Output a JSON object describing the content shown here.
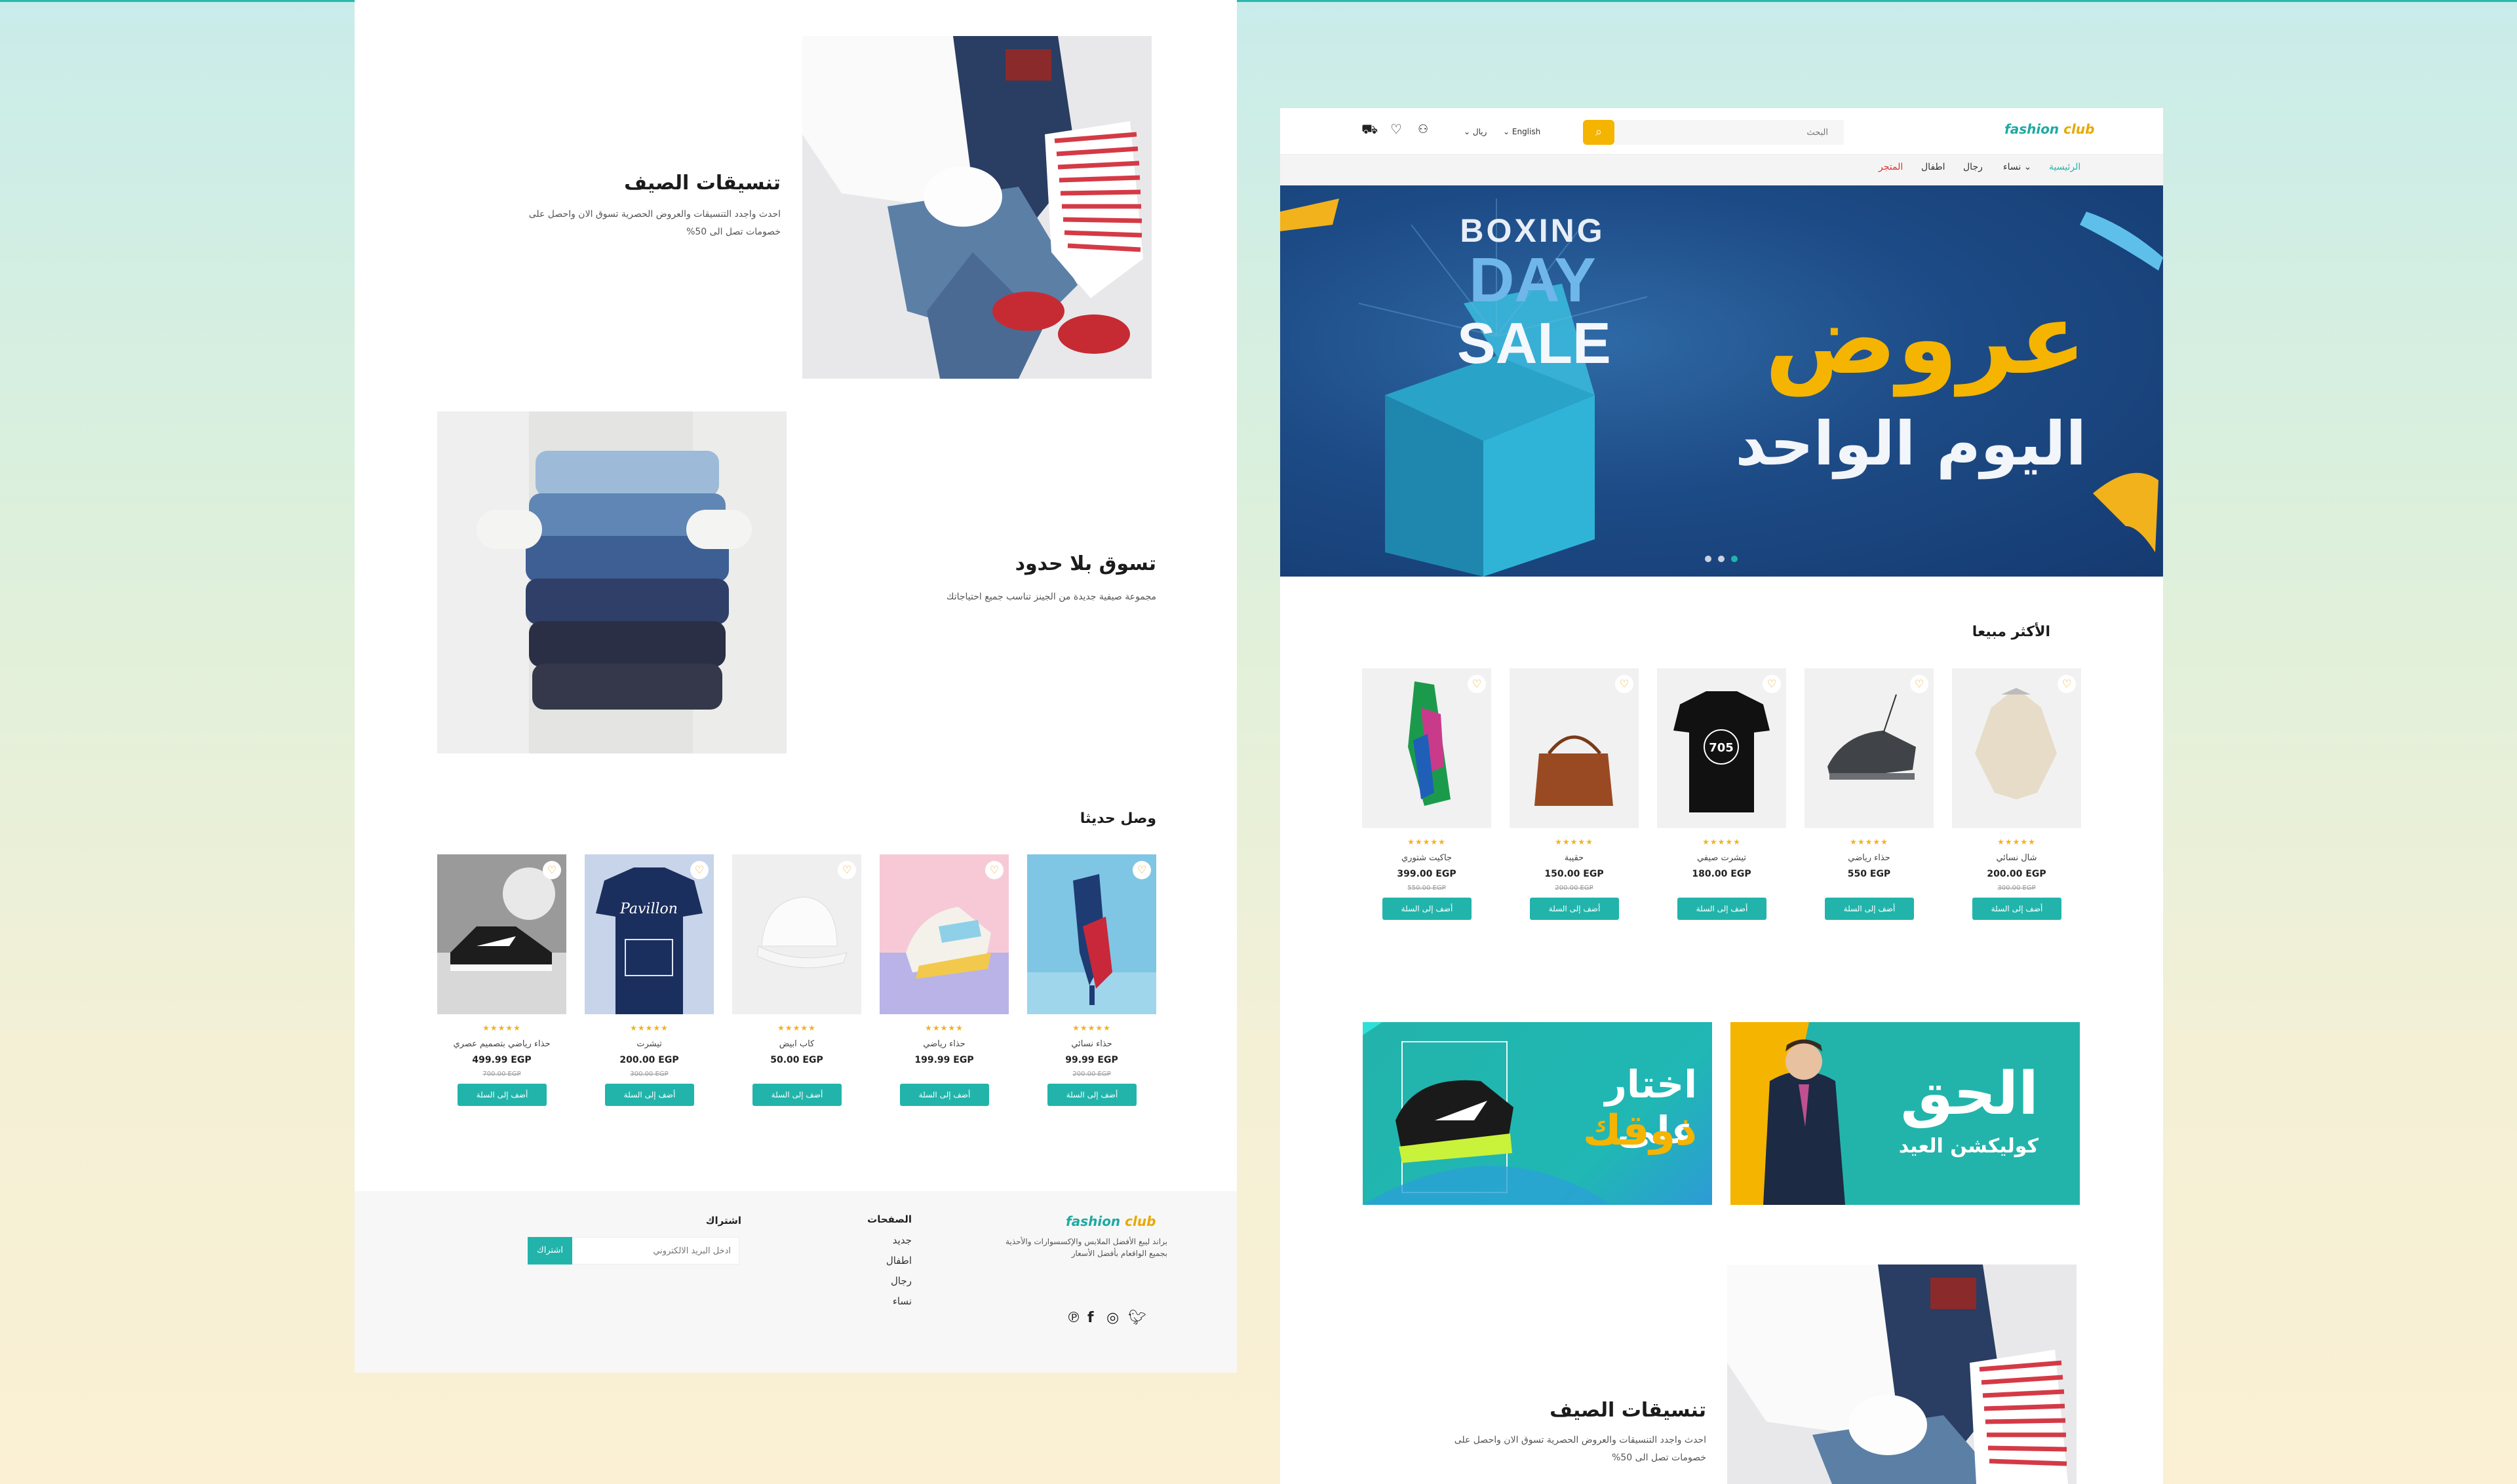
{
  "colors": {
    "accent": "#22b4ab",
    "brand_yellow": "#f5b400",
    "sale_red": "#e03131"
  },
  "brand": {
    "logo_part1": "fashion",
    "logo_part2": "club"
  },
  "left_panel": {
    "summer": {
      "title": "تنسيقات الصيف",
      "desc_line1": "احدث واجدد التنسيقات والعروض الحصرية تسوق الان واحصل على",
      "desc_line2": "خصومات تصل الى 50%"
    },
    "shop": {
      "title": "تسوق بلا حدود",
      "desc": "مجموعة صيفية جديدة من الجينز تناسب جميع احتياجاتك"
    },
    "new_arrivals": {
      "title": "وصل حديثا",
      "products": [
        {
          "name": "حذاء نسائي",
          "price": "99.99 EGP",
          "old": "200.00 EGP",
          "stars": "★★★★★",
          "cta": "أضف إلى السلة"
        },
        {
          "name": "حذاء رياضي",
          "price": "199.99 EGP",
          "old": "",
          "stars": "★★★★★",
          "cta": "أضف إلى السلة"
        },
        {
          "name": "كاب ابيض",
          "price": "50.00 EGP",
          "old": "",
          "stars": "★★★★★",
          "cta": "أضف إلى السلة"
        },
        {
          "name": "تيشرت",
          "price": "200.00 EGP",
          "old": "300.00 EGP",
          "stars": "★★★★★",
          "cta": "أضف إلى السلة"
        },
        {
          "name": "حذاء رياضي بتصميم عصري",
          "price": "499.99 EGP",
          "old": "700.00 EGP",
          "stars": "★★★★★",
          "cta": "أضف إلى السلة"
        }
      ]
    },
    "footer": {
      "about_line1": "براند ليبع الأفضل الملابس والإكسسوارات والأحذية",
      "about_line2": "بجميع الواقعام بأفضل الأسعار",
      "pages_title": "الصفحات",
      "pages": [
        "جديد",
        "اطفال",
        "رجال",
        "نساء"
      ],
      "subscribe_title": "اشتراك",
      "email_placeholder": "ادخل البريد الالكتروني",
      "subscribe_btn": "اشتراك"
    }
  },
  "right_panel": {
    "header": {
      "search_placeholder": "البحث",
      "language": "English",
      "currency": "ريال"
    },
    "nav": {
      "home": "الرئيسية",
      "women": "نساء",
      "men": "رجال",
      "kids": "اطفال",
      "store": "المتجر"
    },
    "hero": {
      "boxing": "BOXING",
      "day": "DAY",
      "sale": "SALE",
      "offer_title": "عروض",
      "offer_sub": "اليوم الواحد"
    },
    "best_sellers": {
      "title": "الأكثر مبيعا",
      "products": [
        {
          "name": "شال نسائي",
          "price": "200.00 EGP",
          "old": "300.00 EGP",
          "stars": "★★★★★",
          "cta": "أضف إلى السلة"
        },
        {
          "name": "حذاء رياضي",
          "price": "550 EGP",
          "old": "",
          "stars": "★★★★★",
          "cta": "أضف إلى السلة"
        },
        {
          "name": "تيشرت صيفي",
          "price": "180.00 EGP",
          "old": "",
          "stars": "★★★★★",
          "cta": "أضف إلى السلة"
        },
        {
          "name": "حقيبة",
          "price": "150.00 EGP",
          "old": "200.00 EGP",
          "stars": "★★★★★",
          "cta": "أضف إلى السلة"
        },
        {
          "name": "جاكيت شتوري",
          "price": "399.00 EGP",
          "old": "550.00 EGP",
          "stars": "★★★★★",
          "cta": "أضف إلى السلة"
        }
      ]
    },
    "banner1": {
      "line1": "الحق",
      "line2": "كوليكشن العيد"
    },
    "banner2": {
      "line1": "اختار على",
      "line2": "ذوقك"
    },
    "summer": {
      "title": "تنسيقات الصيف",
      "desc_line1": "احدث واجدد التنسيقات والعروض الحصرية تسوق الان واحصل على",
      "desc_line2": "خصومات تصل الى 50%"
    }
  }
}
